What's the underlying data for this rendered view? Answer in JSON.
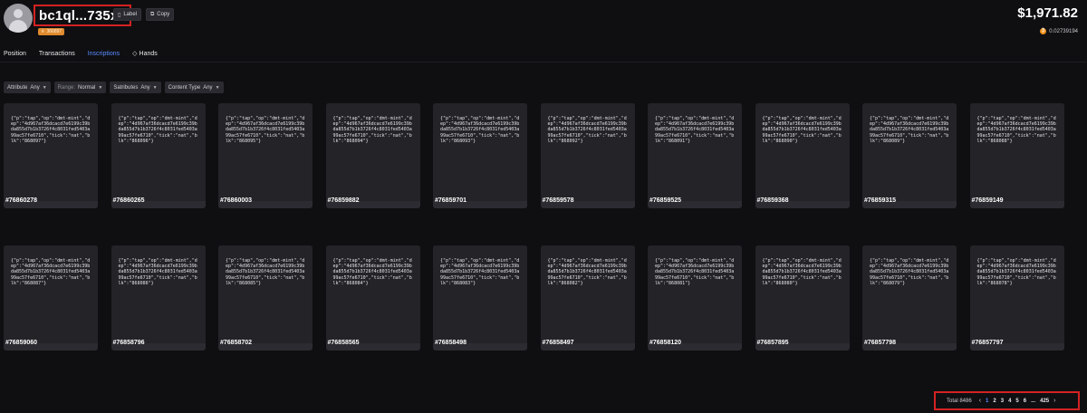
{
  "header": {
    "address": "bc1ql...735x0",
    "label_button": "Label",
    "copy_button": "Copy",
    "badge": "366897",
    "balance_usd": "$1,971.82",
    "balance_btc": "0.02739194"
  },
  "tabs": [
    {
      "label": "Position",
      "active": false
    },
    {
      "label": "Transactions",
      "active": false
    },
    {
      "label": "Inscriptions",
      "active": true
    },
    {
      "label": "Hands",
      "active": false
    }
  ],
  "filters": [
    {
      "label": "Attribute",
      "value": "Any"
    },
    {
      "label": "Range:",
      "value": "Normal"
    },
    {
      "label": "Satributes",
      "value": "Any"
    },
    {
      "label": "Content Type",
      "value": "Any"
    }
  ],
  "cards": [
    {
      "json": "{\"p\":\"tap\",\"op\":\"dmt-mint\",\"dep\":\"4d967af36dcacd7e6199c39bda855d7b1b3726f4c8031fed5403a99ac57fe6710\",\"tick\":\"nat\",\"blk\":\"868097\"}",
      "id": "#76860278"
    },
    {
      "json": "{\"p\":\"tap\",\"op\":\"dmt-mint\",\"dep\":\"4d967af36dcacd7e6199c39bda855d7b1b3726f4c8031fed5403a99ac57fe6710\",\"tick\":\"nat\",\"blk\":\"868096\"}",
      "id": "#76860265"
    },
    {
      "json": "{\"p\":\"tap\",\"op\":\"dmt-mint\",\"dep\":\"4d967af36dcacd7e6199c39bda855d7b1b3726f4c8031fed5403a99ac57fe6710\",\"tick\":\"nat\",\"blk\":\"868095\"}",
      "id": "#76860003"
    },
    {
      "json": "{\"p\":\"tap\",\"op\":\"dmt-mint\",\"dep\":\"4d967af36dcacd7e6199c39bda855d7b1b3726f4c8031fed5403a99ac57fe6710\",\"tick\":\"nat\",\"blk\":\"868094\"}",
      "id": "#76859882"
    },
    {
      "json": "{\"p\":\"tap\",\"op\":\"dmt-mint\",\"dep\":\"4d967af36dcacd7e6199c39bda855d7b1b3726f4c8031fed5403a99ac57fe6710\",\"tick\":\"nat\",\"blk\":\"868093\"}",
      "id": "#76859701"
    },
    {
      "json": "{\"p\":\"tap\",\"op\":\"dmt-mint\",\"dep\":\"4d967af36dcacd7e6199c39bda855d7b1b3726f4c8031fed5403a99ac57fe6710\",\"tick\":\"nat\",\"blk\":\"868092\"}",
      "id": "#76859578"
    },
    {
      "json": "{\"p\":\"tap\",\"op\":\"dmt-mint\",\"dep\":\"4d967af36dcacd7e6199c39bda855d7b1b3726f4c8031fed5403a99ac57fe6710\",\"tick\":\"nat\",\"blk\":\"868091\"}",
      "id": "#76859525"
    },
    {
      "json": "{\"p\":\"tap\",\"op\":\"dmt-mint\",\"dep\":\"4d967af36dcacd7e6199c39bda855d7b1b3726f4c8031fed5403a99ac57fe6710\",\"tick\":\"nat\",\"blk\":\"868090\"}",
      "id": "#76859368"
    },
    {
      "json": "{\"p\":\"tap\",\"op\":\"dmt-mint\",\"dep\":\"4d967af36dcacd7e6199c39bda855d7b1b3726f4c8031fed5403a99ac57fe6710\",\"tick\":\"nat\",\"blk\":\"868089\"}",
      "id": "#76859315"
    },
    {
      "json": "{\"p\":\"tap\",\"op\":\"dmt-mint\",\"dep\":\"4d967af36dcacd7e6199c39bda855d7b1b3726f4c8031fed5403a99ac57fe6710\",\"tick\":\"nat\",\"blk\":\"868088\"}",
      "id": "#76859149"
    },
    {
      "json": "{\"p\":\"tap\",\"op\":\"dmt-mint\",\"dep\":\"4d967af36dcacd7e6199c39bda855d7b1b3726f4c8031fed5403a99ac57fe6710\",\"tick\":\"nat\",\"blk\":\"868087\"}",
      "id": "#76859060"
    },
    {
      "json": "{\"p\":\"tap\",\"op\":\"dmt-mint\",\"dep\":\"4d967af36dcacd7e6199c39bda855d7b1b3726f4c8031fed5403a99ac57fe6710\",\"tick\":\"nat\",\"blk\":\"868086\"}",
      "id": "#76858796"
    },
    {
      "json": "{\"p\":\"tap\",\"op\":\"dmt-mint\",\"dep\":\"4d967af36dcacd7e6199c39bda855d7b1b3726f4c8031fed5403a99ac57fe6710\",\"tick\":\"nat\",\"blk\":\"868085\"}",
      "id": "#76858702"
    },
    {
      "json": "{\"p\":\"tap\",\"op\":\"dmt-mint\",\"dep\":\"4d967af36dcacd7e6199c39bda855d7b1b3726f4c8031fed5403a99ac57fe6710\",\"tick\":\"nat\",\"blk\":\"868084\"}",
      "id": "#76858565"
    },
    {
      "json": "{\"p\":\"tap\",\"op\":\"dmt-mint\",\"dep\":\"4d967af36dcacd7e6199c39bda855d7b1b3726f4c8031fed5403a99ac57fe6710\",\"tick\":\"nat\",\"blk\":\"868083\"}",
      "id": "#76858498"
    },
    {
      "json": "{\"p\":\"tap\",\"op\":\"dmt-mint\",\"dep\":\"4d967af36dcacd7e6199c39bda855d7b1b3726f4c8031fed5403a99ac57fe6710\",\"tick\":\"nat\",\"blk\":\"868082\"}",
      "id": "#76858497"
    },
    {
      "json": "{\"p\":\"tap\",\"op\":\"dmt-mint\",\"dep\":\"4d967af36dcacd7e6199c39bda855d7b1b3726f4c8031fed5403a99ac57fe6710\",\"tick\":\"nat\",\"blk\":\"868081\"}",
      "id": "#76858120"
    },
    {
      "json": "{\"p\":\"tap\",\"op\":\"dmt-mint\",\"dep\":\"4d967af36dcacd7e6199c39bda855d7b1b3726f4c8031fed5403a99ac57fe6710\",\"tick\":\"nat\",\"blk\":\"868080\"}",
      "id": "#76857895"
    },
    {
      "json": "{\"p\":\"tap\",\"op\":\"dmt-mint\",\"dep\":\"4d967af36dcacd7e6199c39bda855d7b1b3726f4c8031fed5403a99ac57fe6710\",\"tick\":\"nat\",\"blk\":\"868079\"}",
      "id": "#76857798"
    },
    {
      "json": "{\"p\":\"tap\",\"op\":\"dmt-mint\",\"dep\":\"4d967af36dcacd7e6199c39bda855d7b1b3726f4c8031fed5403a99ac57fe6710\",\"tick\":\"nat\",\"blk\":\"868078\"}",
      "id": "#76857797"
    }
  ],
  "pagination": {
    "total": "Total 8486",
    "pages": [
      "1",
      "2",
      "3",
      "4",
      "5",
      "6",
      "...",
      "425"
    ],
    "current": "1"
  }
}
